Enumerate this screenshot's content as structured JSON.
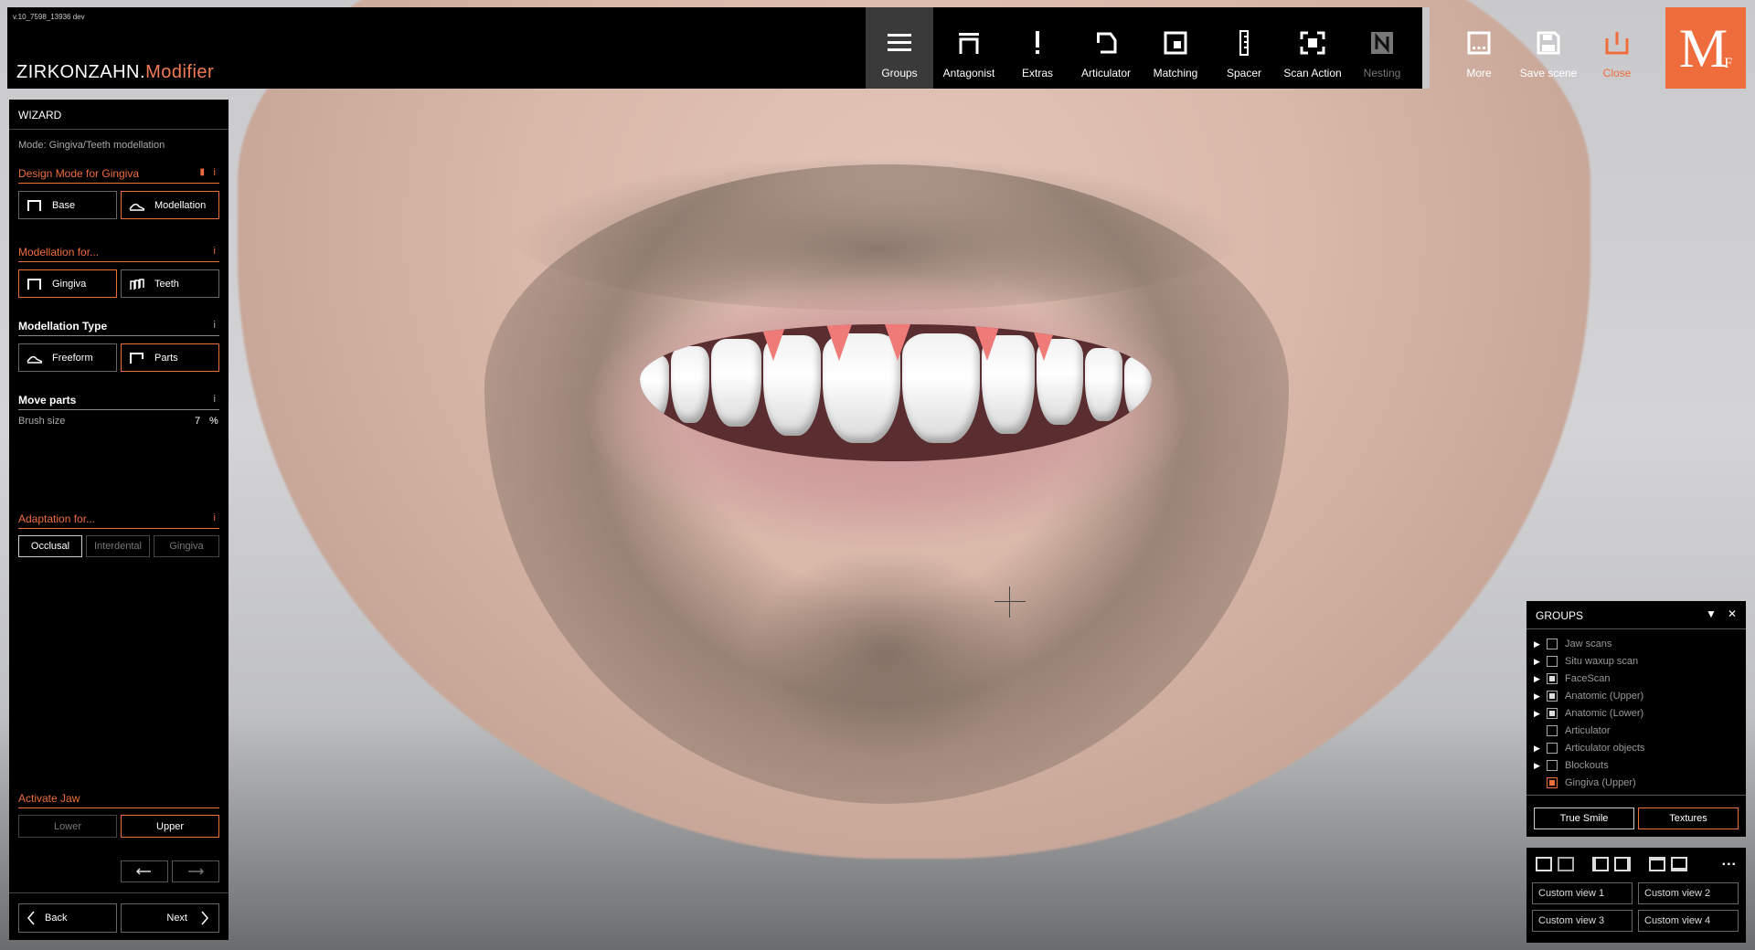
{
  "app": {
    "version": "v.10_7598_13936 dev",
    "brand_main": "ZIRKONZAHN.",
    "brand_sub": "Modifier",
    "logo_main": "M",
    "logo_sub": "F",
    "accent_color": "#ef6d3c"
  },
  "toolbar": {
    "groups": "Groups",
    "antagonist": "Antagonist",
    "extras": "Extras",
    "articulator": "Articulator",
    "matching": "Matching",
    "spacer": "Spacer",
    "scan_action": "Scan Action",
    "nesting": "Nesting",
    "more": "More",
    "save_scene": "Save scene",
    "close": "Close"
  },
  "wizard": {
    "title": "WIZARD",
    "mode": "Mode: Gingiva/Teeth modellation",
    "design_mode_label": "Design Mode for Gingiva",
    "design_base": "Base",
    "design_modellation": "Modellation",
    "modellation_for_label": "Modellation for...",
    "mod_gingiva": "Gingiva",
    "mod_teeth": "Teeth",
    "modellation_type_label": "Modellation Type",
    "type_freeform": "Freeform",
    "type_parts": "Parts",
    "move_parts_label": "Move parts",
    "brush_size_label": "Brush size",
    "brush_size_value": "7",
    "brush_size_unit": "%",
    "adaptation_label": "Adaptation for...",
    "adapt_occlusal": "Occlusal",
    "adapt_interdental": "Interdental",
    "adapt_gingiva": "Gingiva",
    "activate_jaw_label": "Activate Jaw",
    "jaw_lower": "Lower",
    "jaw_upper": "Upper",
    "info": "i",
    "back": "Back",
    "next": "Next"
  },
  "groups_panel": {
    "title": "GROUPS",
    "items": [
      {
        "label": "Jaw scans",
        "expand": true,
        "checked": "off"
      },
      {
        "label": "Situ waxup scan",
        "expand": true,
        "checked": "off"
      },
      {
        "label": "FaceScan",
        "expand": true,
        "checked": "on"
      },
      {
        "label": "Anatomic (Upper)",
        "expand": true,
        "checked": "on"
      },
      {
        "label": "Anatomic (Lower)",
        "expand": true,
        "checked": "on"
      },
      {
        "label": "Articulator",
        "expand": false,
        "checked": "off"
      },
      {
        "label": "Articulator objects",
        "expand": true,
        "checked": "off"
      },
      {
        "label": "Blockouts",
        "expand": true,
        "checked": "off"
      },
      {
        "label": "Gingiva (Upper)",
        "expand": false,
        "checked": "red"
      }
    ],
    "true_smile": "True Smile",
    "textures": "Textures"
  },
  "views_panel": {
    "more": "...",
    "custom_view_1": "Custom view 1",
    "custom_view_2": "Custom view 2",
    "custom_view_3": "Custom view 3",
    "custom_view_4": "Custom view 4"
  }
}
